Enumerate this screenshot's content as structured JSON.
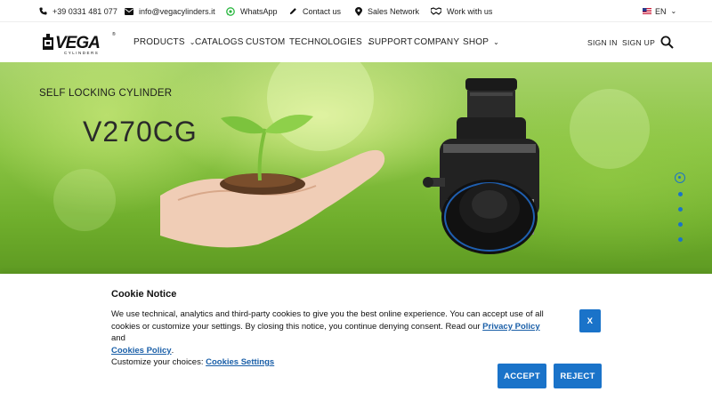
{
  "topbar": {
    "phone": "+39 0331 481 077",
    "email": "info@vegacylinders.it",
    "whatsapp": "WhatsApp",
    "contact": "Contact us",
    "sales": "Sales Network",
    "work": "Work with us",
    "language": "EN"
  },
  "header": {
    "logo_text": "VEGA",
    "logo_sub": "CYLINDERS",
    "nav": {
      "products": "PRODUCTS",
      "catalogs": "CATALOGS",
      "custom": "CUSTOM",
      "technologies": "TECHNOLOGIES",
      "support": "SUPPORT",
      "company": "COMPANY",
      "shop": "SHOP"
    },
    "sign_in": "SIGN IN",
    "sign_up": "SIGN UP"
  },
  "hero": {
    "subtitle": "SELF LOCKING CYLINDER",
    "title": "V270CG",
    "slide_count": 5,
    "active_slide": 1
  },
  "cookie": {
    "title": "Cookie Notice",
    "text_1": "We use technical, analytics and third-party cookies to give you the best online experience. You can accept use of all cookies or customize your settings. By closing this notice, you continue denying consent. Read our ",
    "privacy_link": "Privacy Policy",
    "text_2": " and ",
    "cookies_link": "Cookies Policy",
    "text_3": ".",
    "customize_text": "Customize your choices: ",
    "settings_link": "Cookies Settings",
    "close_label": "X",
    "accept_label": "ACCEPT",
    "reject_label": "REJECT"
  },
  "colors": {
    "accent": "#1a73c9",
    "link": "#1a5fa8"
  }
}
